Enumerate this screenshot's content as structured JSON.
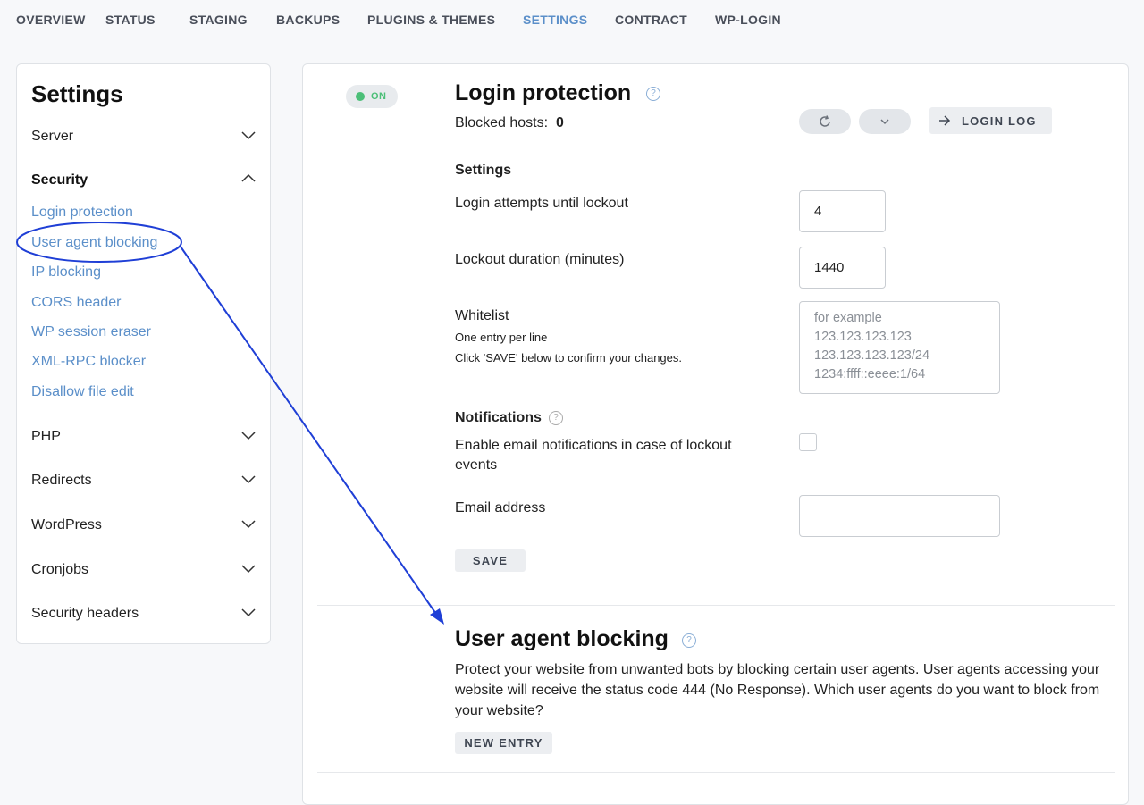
{
  "topnav": {
    "tabs": [
      "OVERVIEW",
      "STATUS",
      "STAGING",
      "BACKUPS",
      "PLUGINS & THEMES",
      "SETTINGS",
      "CONTRACT",
      "WP-LOGIN"
    ],
    "active": "SETTINGS"
  },
  "sidebar": {
    "title": "Settings",
    "sections": [
      "Server",
      "Security",
      "PHP",
      "Redirects",
      "WordPress",
      "Cronjobs",
      "Security headers"
    ],
    "security_items": [
      "Login protection",
      "User agent blocking",
      "IP blocking",
      "CORS header",
      "WP session eraser",
      "XML-RPC blocker",
      "Disallow file edit"
    ]
  },
  "login": {
    "toggle": "ON",
    "title": "Login protection",
    "blocked_label": "Blocked hosts:",
    "blocked_count": "0",
    "login_log": "LOGIN LOG",
    "settings_heading": "Settings",
    "attempts_label": "Login attempts until lockout",
    "attempts_value": "4",
    "duration_label": "Lockout duration (minutes)",
    "duration_value": "1440",
    "whitelist_label": "Whitelist",
    "whitelist_hint1": "One entry per line",
    "whitelist_hint2": "Click 'SAVE' below to confirm your changes.",
    "whitelist_placeholder": "for example\n123.123.123.123\n123.123.123.123/24\n1234:ffff::eeee:1/64",
    "notifications_heading": "Notifications",
    "notify_label": "Enable email notifications in case of lockout events",
    "email_label": "Email address",
    "email_value": "",
    "save": "SAVE"
  },
  "uab": {
    "title": "User agent blocking",
    "description": "Protect your website from unwanted bots by blocking certain user agents. User agents accessing your website will receive the status code 444 (No Response). Which user agents do you want to block from your website?",
    "new_entry": "NEW ENTRY"
  },
  "colors": {
    "accent": "#5b8fc9",
    "on_green": "#4cbf78",
    "annotation": "#1f3fd6"
  }
}
